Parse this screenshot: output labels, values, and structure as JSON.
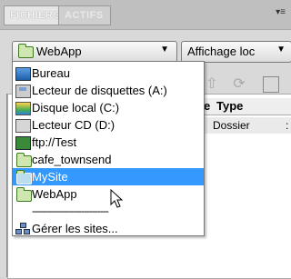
{
  "panel": {
    "tabs": [
      "FICHIERS",
      "ACTIFS"
    ],
    "menu_glyph": "▾≡"
  },
  "site_select": {
    "value": "WebApp",
    "icon": "site-folder-icon",
    "arrow": "▼"
  },
  "view_select": {
    "value": "Affichage loc",
    "arrow": "▼"
  },
  "file_list": {
    "columns": [
      "e",
      "Type"
    ],
    "rows": [
      {
        "type": "Dossier",
        "extra": ":"
      }
    ]
  },
  "dropdown": {
    "items": [
      {
        "label": "Bureau",
        "icon": "desktop-icon"
      },
      {
        "label": "Lecteur de disquettes (A:)",
        "icon": "floppy-drive-icon"
      },
      {
        "label": "Disque local (C:)",
        "icon": "local-disk-icon"
      },
      {
        "label": "Lecteur CD (D:)",
        "icon": "cd-drive-icon"
      },
      {
        "label": "ftp://Test",
        "icon": "ftp-server-icon"
      },
      {
        "label": "cafe_townsend",
        "icon": "site-folder-icon"
      },
      {
        "label": "MySite",
        "icon": "site-folder-icon",
        "selected": true
      },
      {
        "label": "WebApp",
        "icon": "site-folder-icon"
      }
    ],
    "separator": "----------------------------",
    "manage_label": "Gérer les sites..."
  },
  "colors": {
    "selection": "#3399ff",
    "folder_green": "#3d7a1f"
  }
}
